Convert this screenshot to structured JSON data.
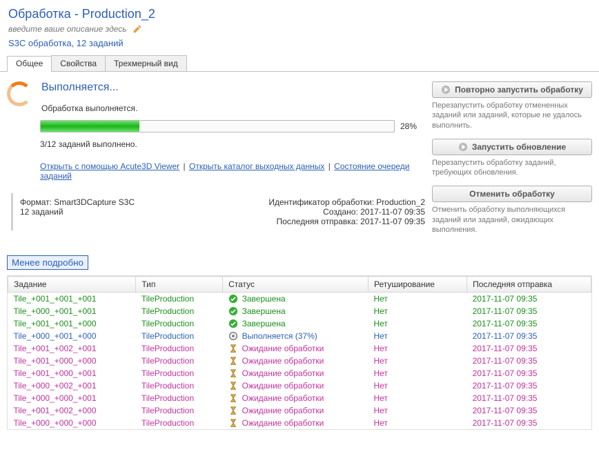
{
  "header": {
    "title": "Обработка - Production_2",
    "desc_placeholder": "введите ваше описание здесь",
    "summary": "S3C обработка, 12 заданий"
  },
  "tabs": {
    "general": "Общее",
    "properties": "Свойства",
    "view3d": "Трехмерный вид"
  },
  "status": {
    "title": "Выполняется...",
    "sub": "Обработка выполняется.",
    "progress_pct": "28%",
    "progress_width": "28%",
    "done_line": "3/12 заданий выполнено."
  },
  "links": {
    "open_viewer": "Открыть с помощью Acute3D Viewer",
    "open_output": "Открыть каталог выходных данных",
    "queue": "Состояние очереди заданий"
  },
  "meta": {
    "format_label": "Формат: Smart3DCapture S3C",
    "jobs_label": "12 заданий",
    "id_label": "Идентификатор обработки: Production_2",
    "created_label": "Создано: 2017-11-07 09:35",
    "last_label": "Последняя отправка: 2017-11-07 09:35"
  },
  "right": {
    "rerun": "Повторно запустить обработку",
    "rerun_desc": "Перезапустить обработку отмененных заданий или заданий, которые не удалось выполнить.",
    "update": "Запустить обновление",
    "update_desc": "Перезапустить обработку заданий, требующих обновления.",
    "cancel": "Отменить обработку",
    "cancel_desc": "Отменить обработку выполняющихся заданий или заданий, ожидающих выполнения."
  },
  "toggle": "Менее подробно",
  "table": {
    "headers": {
      "task": "Задание",
      "type": "Тип",
      "status": "Статус",
      "retouch": "Ретуширование",
      "last": "Последняя отправка"
    },
    "rows": [
      {
        "task": "Tile_+001_+001_+001",
        "type": "TileProduction",
        "status": "Завершена",
        "retouch": "Нет",
        "last": "2017-11-07 09:35",
        "cls": "c-green",
        "icon": "check"
      },
      {
        "task": "Tile_+000_+001_+001",
        "type": "TileProduction",
        "status": "Завершена",
        "retouch": "Нет",
        "last": "2017-11-07 09:35",
        "cls": "c-green",
        "icon": "check"
      },
      {
        "task": "Tile_+001_+001_+000",
        "type": "TileProduction",
        "status": "Завершена",
        "retouch": "Нет",
        "last": "2017-11-07 09:35",
        "cls": "c-green",
        "icon": "check"
      },
      {
        "task": "Tile_+000_+001_+000",
        "type": "TileProduction",
        "status": "Выполняется (37%)",
        "retouch": "Нет",
        "last": "2017-11-07 09:35",
        "cls": "c-blue",
        "icon": "gear"
      },
      {
        "task": "Tile_+001_+002_+001",
        "type": "TileProduction",
        "status": "Ожидание обработки",
        "retouch": "Нет",
        "last": "2017-11-07 09:35",
        "cls": "c-pink",
        "icon": "hourglass"
      },
      {
        "task": "Tile_+001_+000_+000",
        "type": "TileProduction",
        "status": "Ожидание обработки",
        "retouch": "Нет",
        "last": "2017-11-07 09:35",
        "cls": "c-pink",
        "icon": "hourglass"
      },
      {
        "task": "Tile_+001_+000_+001",
        "type": "TileProduction",
        "status": "Ожидание обработки",
        "retouch": "Нет",
        "last": "2017-11-07 09:35",
        "cls": "c-pink",
        "icon": "hourglass"
      },
      {
        "task": "Tile_+000_+002_+001",
        "type": "TileProduction",
        "status": "Ожидание обработки",
        "retouch": "Нет",
        "last": "2017-11-07 09:35",
        "cls": "c-pink",
        "icon": "hourglass"
      },
      {
        "task": "Tile_+000_+000_+001",
        "type": "TileProduction",
        "status": "Ожидание обработки",
        "retouch": "Нет",
        "last": "2017-11-07 09:35",
        "cls": "c-pink",
        "icon": "hourglass"
      },
      {
        "task": "Tile_+001_+002_+000",
        "type": "TileProduction",
        "status": "Ожидание обработки",
        "retouch": "Нет",
        "last": "2017-11-07 09:35",
        "cls": "c-pink",
        "icon": "hourglass"
      },
      {
        "task": "Tile_+000_+000_+000",
        "type": "TileProduction",
        "status": "Ожидание обработки",
        "retouch": "Нет",
        "last": "2017-11-07 09:35",
        "cls": "c-pink",
        "icon": "hourglass"
      }
    ]
  }
}
